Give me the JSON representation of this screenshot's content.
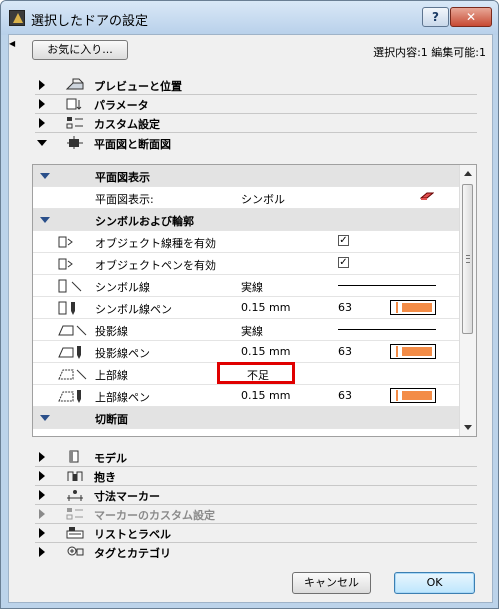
{
  "window": {
    "title": "選択したドアの設定",
    "help_label": "?",
    "close_label": "✕"
  },
  "toolbar": {
    "favorites_label": "お気に入り...",
    "selection_info": "選択内容:1 編集可能:1"
  },
  "categories_top": [
    {
      "label": "プレビューと位置",
      "icon": "preview-position-icon"
    },
    {
      "label": "パラメータ",
      "icon": "parameters-icon"
    },
    {
      "label": "カスタム設定",
      "icon": "custom-settings-icon"
    },
    {
      "label": "平面図と断面図",
      "icon": "floor-plan-section-icon"
    }
  ],
  "panel": {
    "rows": [
      {
        "type": "group",
        "label": "平面図表示"
      },
      {
        "type": "prop",
        "name": "平面図表示:",
        "value": "シンボル"
      },
      {
        "type": "group",
        "label": "シンボルおよび輪郭"
      },
      {
        "type": "prop",
        "name": "オブジェクト線種を有効",
        "check": "✓"
      },
      {
        "type": "prop",
        "name": "オブジェクトペンを有効",
        "check": "✓"
      },
      {
        "type": "prop",
        "name": "シンボル線",
        "value": "実線"
      },
      {
        "type": "prop",
        "name": "シンボル線ペン",
        "value": "0.15 mm",
        "pen": "63"
      },
      {
        "type": "prop",
        "name": "投影線",
        "value": "実線"
      },
      {
        "type": "prop",
        "name": "投影線ペン",
        "value": "0.15 mm",
        "pen": "63"
      },
      {
        "type": "prop",
        "name": "上部線",
        "value": "不足"
      },
      {
        "type": "prop",
        "name": "上部線ペン",
        "value": "0.15 mm",
        "pen": "63"
      },
      {
        "type": "group",
        "label": "切断面"
      }
    ]
  },
  "categories_bottom": [
    {
      "label": "モデル",
      "icon": "model-icon"
    },
    {
      "label": "抱き",
      "icon": "reveal-icon"
    },
    {
      "label": "寸法マーカー",
      "icon": "dimension-marker-icon"
    },
    {
      "label": "マーカーのカスタム設定",
      "icon": "marker-custom-icon"
    },
    {
      "label": "リストとラベル",
      "icon": "list-label-icon"
    },
    {
      "label": "タグとカテゴリ",
      "icon": "tag-category-icon"
    }
  ],
  "buttons": {
    "cancel": "キャンセル",
    "ok": "OK"
  },
  "colors": {
    "pen_swatch": "#f38c47",
    "highlight": "#e00000",
    "titlebar": "#c6dbf2"
  }
}
